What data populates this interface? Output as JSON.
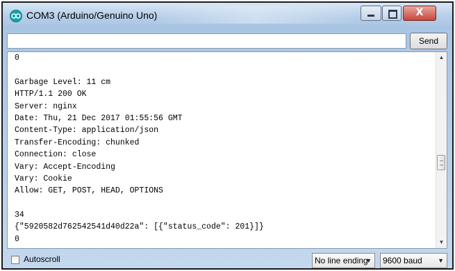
{
  "window": {
    "title": "COM3 (Arduino/Genuino Uno)",
    "close_glyph": "X"
  },
  "input": {
    "value": "",
    "send_label": "Send"
  },
  "output": {
    "lines": [
      "0",
      "",
      "Garbage Level: 11 cm",
      "HTTP/1.1 200 OK",
      "Server: nginx",
      "Date: Thu, 21 Dec 2017 01:55:56 GMT",
      "Content-Type: application/json",
      "Transfer-Encoding: chunked",
      "Connection: close",
      "Vary: Accept-Encoding",
      "Vary: Cookie",
      "Allow: GET, POST, HEAD, OPTIONS",
      "",
      "34",
      "{\"5920582d762542541d40d22a\": [{\"status_code\": 201}]}",
      "0"
    ]
  },
  "footer": {
    "autoscroll_label": "Autoscroll",
    "autoscroll_checked": false,
    "line_ending": "No line ending",
    "baud": "9600 baud"
  },
  "colors": {
    "titlebar": "#b7cfe9",
    "close_button": "#c8463a",
    "app_icon": "#14a3a8"
  },
  "icons": [
    "arduino-icon",
    "minimize-icon",
    "maximize-icon",
    "close-icon",
    "chevron-down-icon",
    "scroll-up-icon",
    "scroll-down-icon"
  ]
}
